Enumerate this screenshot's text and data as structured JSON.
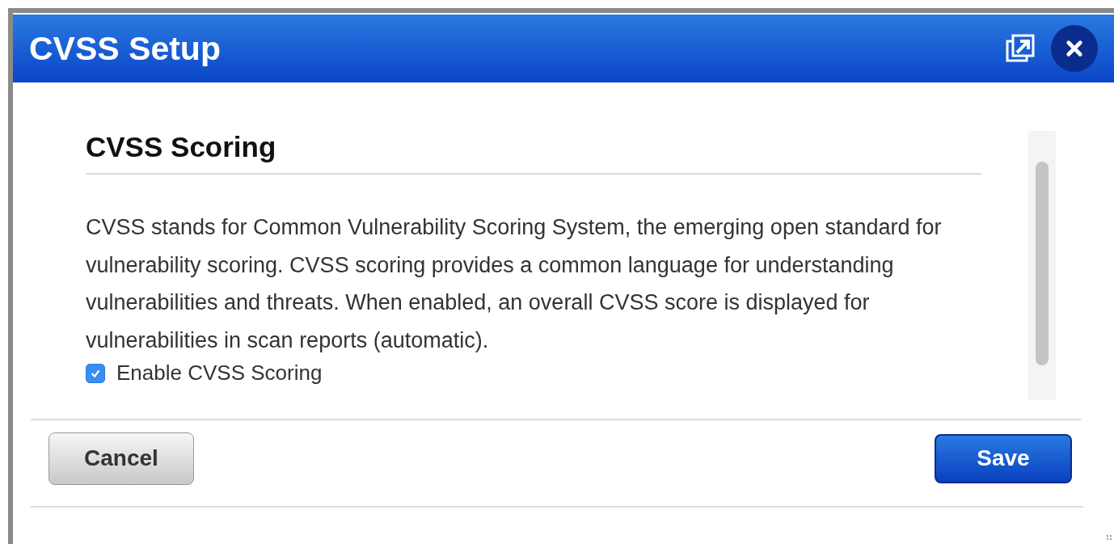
{
  "window": {
    "title": "CVSS Setup"
  },
  "section": {
    "heading": "CVSS Scoring",
    "description": "CVSS stands for Common Vulnerability Scoring System, the emerging open standard for vulnerability scoring. CVSS scoring provides a common language for understanding vulnerabilities and threats. When enabled, an overall CVSS score is displayed for vulnerabilities in scan reports (automatic).",
    "option": {
      "label": "Enable CVSS Scoring",
      "checked": true
    }
  },
  "buttons": [
    {
      "label": "Cancel",
      "kind": "secondary"
    },
    {
      "label": "Save",
      "kind": "primary"
    }
  ]
}
